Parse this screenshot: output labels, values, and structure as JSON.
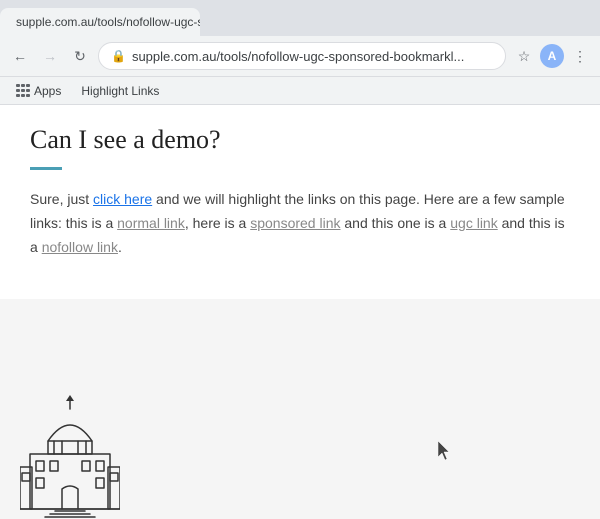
{
  "browser": {
    "tab_title": "supple.com.au/tools/nofollow-ugc-sponsored-bookmarkl...",
    "url": "supple.com.au/tools/nofollow-ugc-sponsored-bookmarkl...",
    "back_disabled": false,
    "forward_disabled": true
  },
  "bookmarks": {
    "apps_label": "Apps",
    "highlight_links_label": "Highlight Links"
  },
  "content": {
    "heading": "Can I see a demo?",
    "intro": "Sure, just ",
    "click_here": "click here",
    "intro_cont": " and we will highlight the links on this page. Here are a few sample links: this is a ",
    "normal_link": "normal link",
    "normal_cont": ", here is a ",
    "sponsored_link": "sponsored link",
    "sponsored_cont": " and this one is a ",
    "ugc_link": "ugc link",
    "ugc_cont": " and this is a ",
    "nofollow_link": "nofollow link",
    "nofollow_end": "."
  }
}
